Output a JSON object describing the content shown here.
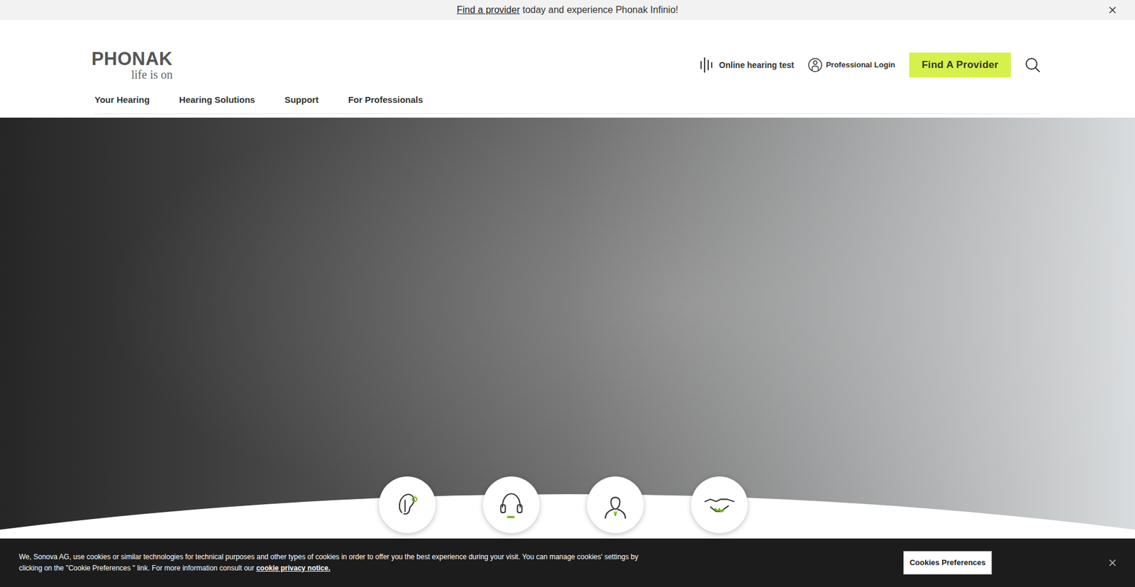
{
  "announcement": {
    "link": "Find a provider",
    "text": " today and experience Phonak Infinio!"
  },
  "logo": {
    "brand": "PHONAK",
    "tagline": "life is on"
  },
  "utility_links": [
    "Online hearing test",
    "Professional Login"
  ],
  "cta": "Find A Provider",
  "nav": [
    "Your Hearing",
    "Hearing Solutions",
    "Support",
    "For Professionals"
  ],
  "feature_icons": [
    "ear",
    "headset",
    "person",
    "handshake"
  ],
  "cookie_banner": {
    "text": "We, Sonova AG, use cookies or similar technologies for technical purposes and other types of cookies in order to offer you the best experience during your visit. You can manage cookies' settings by clicking on the \"Cookie Preferences \" link. For more information consult our",
    "link": "cookie privacy notice.",
    "button": "Cookies Preferences"
  }
}
